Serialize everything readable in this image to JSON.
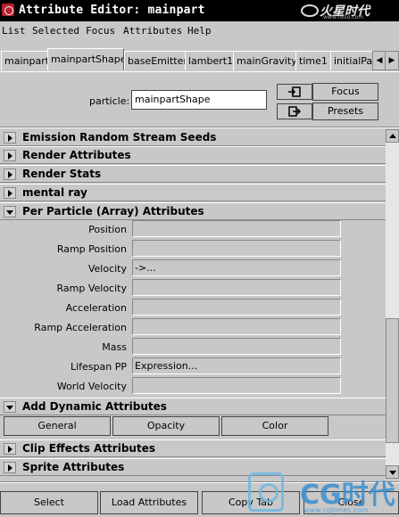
{
  "window": {
    "title": "Attribute Editor: mainpart",
    "watermark_text": "火星时代",
    "watermark_url": "www.hxsd.com"
  },
  "menu": [
    "List",
    "Selected",
    "Focus",
    "Attributes",
    "Help"
  ],
  "tabs": [
    "mainpart",
    "mainpartShape",
    "baseEmitter",
    "lambert1",
    "mainGravity",
    "time1",
    "initialPart"
  ],
  "active_tab": "mainpartShape",
  "particle": {
    "label": "particle:",
    "value": "mainpartShape"
  },
  "header_buttons": {
    "focus": "Focus",
    "presets": "Presets"
  },
  "sections_top": [
    {
      "title": "Emission Random Stream Seeds",
      "expanded": false
    },
    {
      "title": "Render Attributes",
      "expanded": false
    },
    {
      "title": "Render Stats",
      "expanded": false
    },
    {
      "title": "mental ray",
      "expanded": false
    },
    {
      "title": "Per Particle (Array) Attributes",
      "expanded": true
    }
  ],
  "per_particle_rows": [
    {
      "label": "Position",
      "value": ""
    },
    {
      "label": "Ramp Position",
      "value": ""
    },
    {
      "label": "Velocity",
      "value": "->..."
    },
    {
      "label": "Ramp Velocity",
      "value": ""
    },
    {
      "label": "Acceleration",
      "value": ""
    },
    {
      "label": "Ramp Acceleration",
      "value": ""
    },
    {
      "label": "Mass",
      "value": ""
    },
    {
      "label": "Lifespan PP",
      "value": "Expression..."
    },
    {
      "label": "World Velocity",
      "value": ""
    }
  ],
  "add_dynamic": {
    "title": "Add Dynamic Attributes",
    "buttons": [
      "General",
      "Opacity",
      "Color"
    ]
  },
  "sections_bottom": [
    {
      "title": "Clip Effects Attributes",
      "expanded": false
    },
    {
      "title": "Sprite Attributes",
      "expanded": false
    }
  ],
  "bottom_buttons": [
    "Select",
    "Load Attributes",
    "Copy Tab",
    "Close"
  ],
  "bottom_watermark": {
    "text": "CG时代",
    "url": "www.cgtimes.com"
  }
}
